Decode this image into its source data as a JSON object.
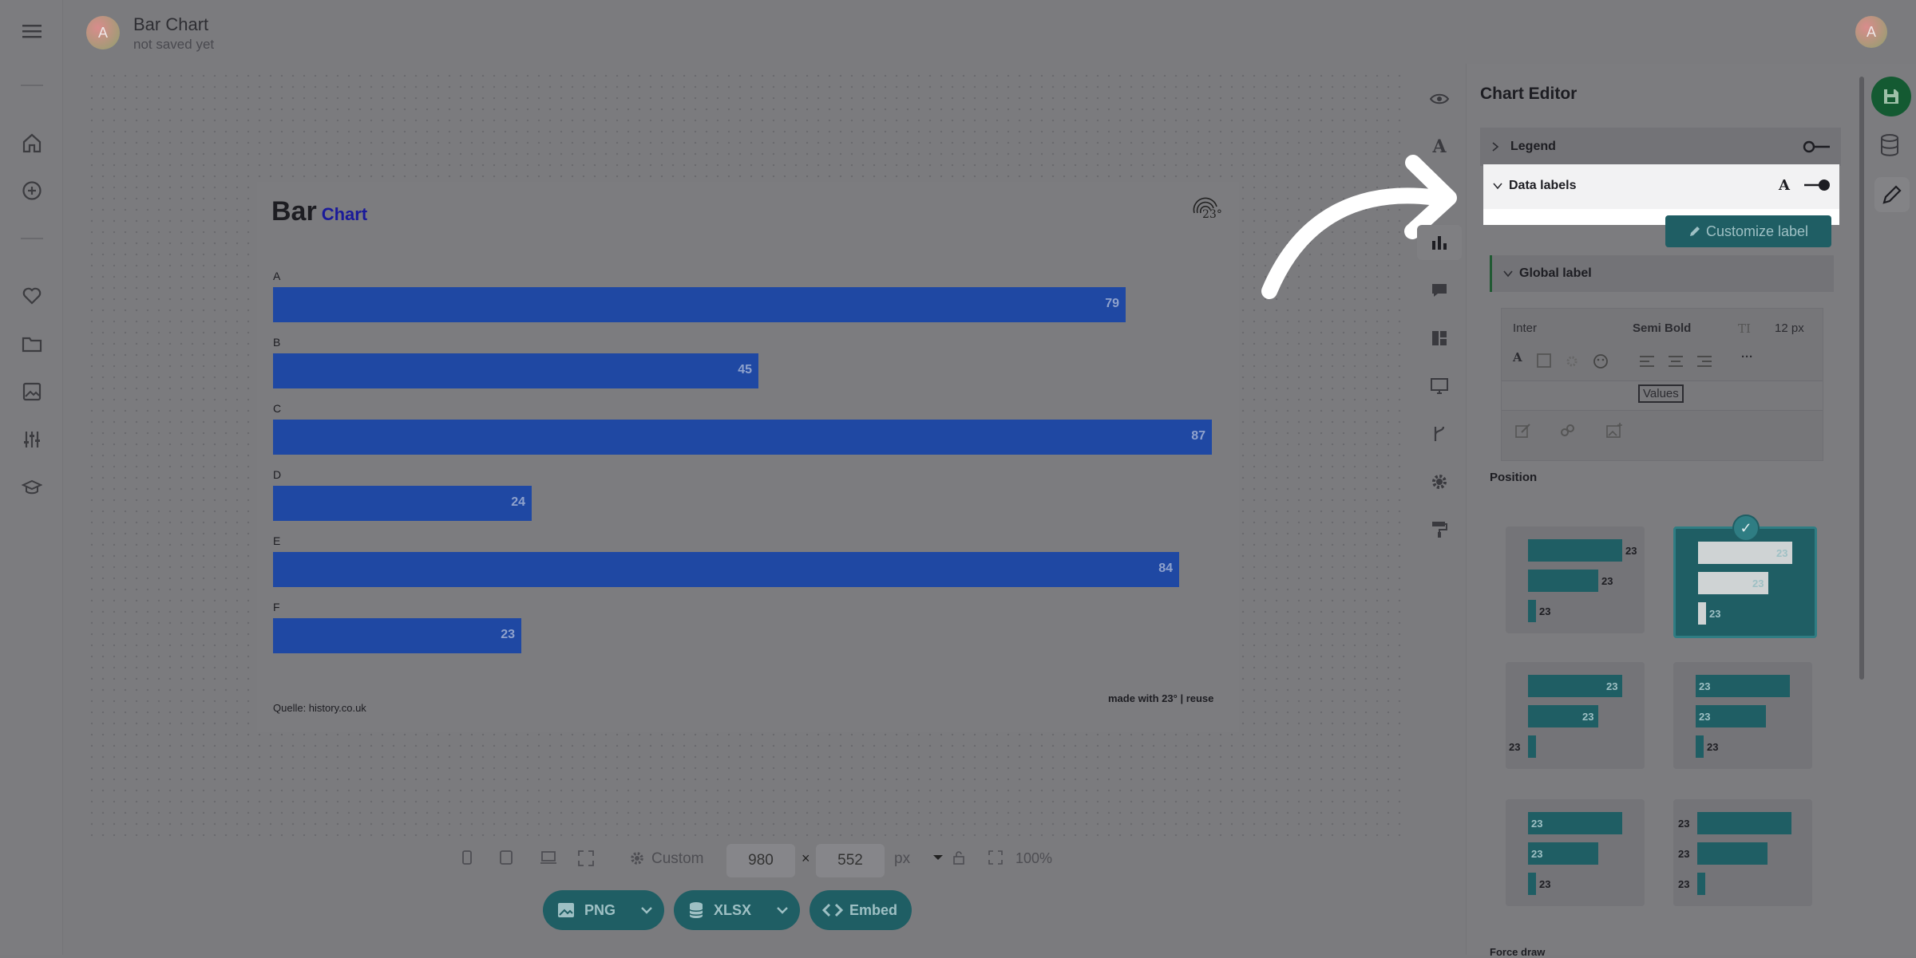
{
  "header": {
    "avatar_initial": "A",
    "doc_title": "Bar Chart",
    "doc_status": "not saved yet",
    "user_initial": "A"
  },
  "left_rail": {
    "icons": [
      "menu-icon",
      "home-icon",
      "plus-circle-icon",
      "heart-icon",
      "folder-icon",
      "image-icon",
      "sliders-icon",
      "graduation-cap-icon"
    ]
  },
  "chart": {
    "title_main": "Bar",
    "title_sub": "Chart",
    "logo_text": "23°",
    "source": "Quelle: history.co.uk",
    "made_with": "made with 23° | reuse"
  },
  "chart_data": {
    "type": "bar",
    "orientation": "horizontal",
    "title": "Bar Chart",
    "categories": [
      "A",
      "B",
      "C",
      "D",
      "E",
      "F"
    ],
    "values": [
      79,
      45,
      87,
      24,
      84,
      23
    ],
    "xlim": [
      0,
      87
    ],
    "bar_color": "#1f48a3",
    "data_labels": "inside-end",
    "grid": false
  },
  "toolbar": {
    "icons": [
      "eye-icon",
      "text-icon",
      "bar-chart-icon",
      "comment-icon",
      "layout-icon",
      "present-icon",
      "branch-icon",
      "gear-icon",
      "paint-roller-icon"
    ]
  },
  "bottom_bar": {
    "size_preset": "Custom",
    "width": "980",
    "times": "×",
    "height": "552",
    "unit": "px",
    "zoom": "100%",
    "png_label": "PNG",
    "xlsx_label": "XLSX",
    "embed_label": "Embed"
  },
  "editor": {
    "title": "Chart Editor",
    "legend_label": "Legend",
    "data_labels_label": "Data labels",
    "customize_label": "Customize label",
    "global_label": "Global label",
    "font_family": "Inter",
    "font_weight": "Semi Bold",
    "font_size": "12 px",
    "font_size_icon": "TI",
    "values_chip": "Values",
    "position_label": "Position",
    "force_draw_label": "Force draw",
    "preview_value": "23"
  },
  "colors": {
    "accent": "#1f5e64",
    "bar": "#1f48a3",
    "save": "#145a32"
  }
}
